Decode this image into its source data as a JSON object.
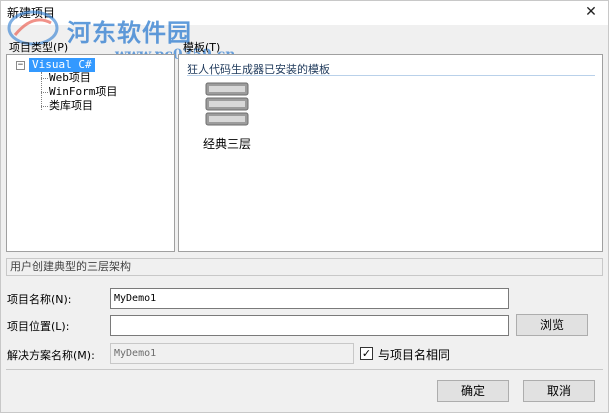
{
  "window": {
    "title": "新建项目",
    "close_glyph": "✕"
  },
  "watermark": {
    "name": "河东软件园",
    "url": "www.pc0359.cn"
  },
  "project_types": {
    "label": "项目类型(P)",
    "root": "Visual C#",
    "expander_glyph": "−",
    "children": [
      "Web项目",
      "WinForm项目",
      "类库项目"
    ]
  },
  "templates": {
    "label": "模板(T)",
    "group_title": "狂人代码生成器已安装的模板",
    "items": [
      {
        "label": "经典三层",
        "icon": "server-stack-icon"
      }
    ]
  },
  "description": "用户创建典型的三层架构",
  "form": {
    "project_name_label": "项目名称(N):",
    "project_name_value": "MyDemo1",
    "project_location_label": "项目位置(L):",
    "project_location_value": "",
    "browse_label": "浏览",
    "solution_name_label": "解决方案名称(M):",
    "solution_name_value": "MyDemo1",
    "same_as_project_label": "与项目名相同",
    "same_as_project_checked": true,
    "check_glyph": "✓"
  },
  "buttons": {
    "ok_label": "确定",
    "cancel_label": "取消"
  }
}
